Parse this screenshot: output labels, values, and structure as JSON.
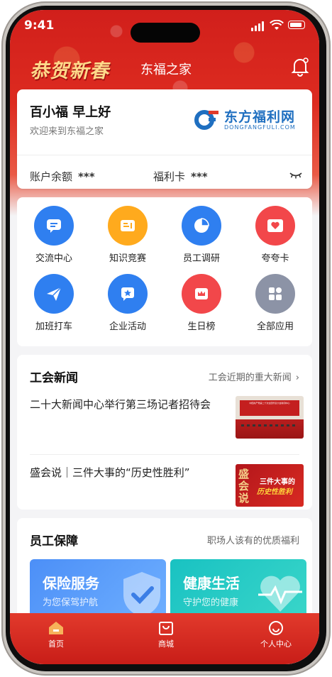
{
  "status": {
    "time": "9:41"
  },
  "header": {
    "logo_text": "恭贺新春",
    "title": "东福之家"
  },
  "user": {
    "greeting": "百小福 早上好",
    "welcome": "欢迎来到东福之家"
  },
  "brand": {
    "name_cn": "东方福利网",
    "name_en": "DONGFANGFULI.COM"
  },
  "account": {
    "balance_label": "账户余额",
    "balance_value": "***",
    "card_label": "福利卡",
    "card_value": "***"
  },
  "shortcuts": [
    {
      "label": "交流中心",
      "icon": "chat-icon",
      "color": "#2f7ff0"
    },
    {
      "label": "知识竞赛",
      "icon": "book-icon",
      "color": "#ffaa1d"
    },
    {
      "label": "员工调研",
      "icon": "pie-chart-icon",
      "color": "#2f7ff0"
    },
    {
      "label": "夸夸卡",
      "icon": "heart-card-icon",
      "color": "#f2474a"
    },
    {
      "label": "加班打车",
      "icon": "send-icon",
      "color": "#2f7ff0"
    },
    {
      "label": "企业活动",
      "icon": "star-flag-icon",
      "color": "#2f7ff0"
    },
    {
      "label": "生日榜",
      "icon": "crown-icon",
      "color": "#f2474a"
    },
    {
      "label": "全部应用",
      "icon": "grid-icon",
      "color": "#8c93a6"
    }
  ],
  "union_news": {
    "title": "工会新闻",
    "more": "工会近期的重大新闻",
    "items": [
      {
        "title": "二十大新闻中心举行第三场记者招待会",
        "image_text": "中国共产党第二十次全国代表大会新闻中心"
      },
      {
        "title": "盛会说｜三件大事的“历史性胜利”",
        "image_text_main": "盛会说",
        "image_text_sub": "三件大事的",
        "image_text_em": "历史性胜利"
      }
    ]
  },
  "benefits": {
    "title": "员工保障",
    "subtitle": "职场人该有的优质福利",
    "banners": [
      {
        "title": "保险服务",
        "subtitle": "为您保驾护航"
      },
      {
        "title": "健康生活",
        "subtitle": "守护您的健康"
      }
    ]
  },
  "tabs": [
    {
      "label": "首页",
      "icon": "home-icon"
    },
    {
      "label": "商城",
      "icon": "shop-icon"
    },
    {
      "label": "个人中心",
      "icon": "user-icon"
    }
  ]
}
